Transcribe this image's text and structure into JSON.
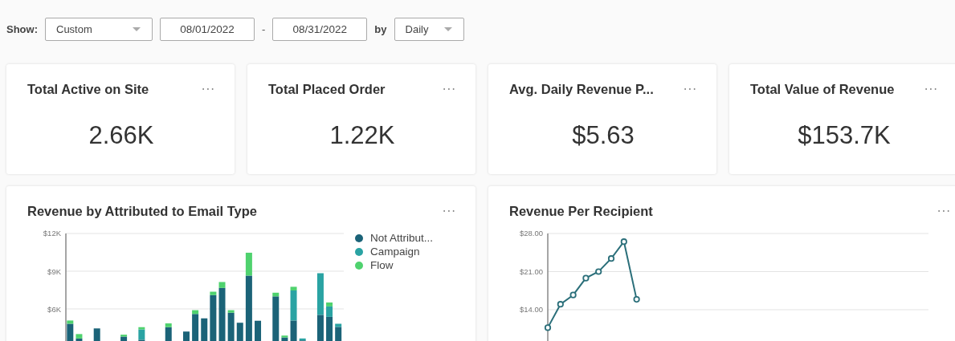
{
  "filter_bar": {
    "show_label": "Show:",
    "range_select": {
      "value": "Custom"
    },
    "start_date": {
      "value": "08/01/2022"
    },
    "separator": "-",
    "end_date": {
      "value": "08/31/2022"
    },
    "by_label": "by",
    "interval_select": {
      "value": "Daily"
    }
  },
  "metrics": [
    {
      "title": "Total Active on Site",
      "menu": "···",
      "value": "2.66K"
    },
    {
      "title": "Total Placed Order",
      "menu": "···",
      "value": "1.22K"
    },
    {
      "title": "Avg. Daily Revenue P...",
      "menu": "···",
      "value": "$5.63"
    },
    {
      "title": "Total Value of Revenue",
      "menu": "···",
      "value": "$153.7K"
    }
  ],
  "charts": [
    {
      "title": "Revenue by Attributed to Email Type",
      "menu": "···",
      "chart_data": {
        "type": "bar",
        "stacked": true,
        "ylim": [
          0,
          12000
        ],
        "yticks": [
          {
            "value": 6000,
            "label": "$6K"
          },
          {
            "value": 9000,
            "label": "$9K"
          },
          {
            "value": 12000,
            "label": "$12K"
          }
        ],
        "series": [
          {
            "name": "Not Attribut...",
            "color": "#1b6378",
            "values": [
              4820,
              3650,
              null,
              4450,
              null,
              null,
              3800,
              null,
              3550,
              null,
              null,
              4550,
              null,
              4200,
              5600,
              5250,
              7100,
              7670,
              5700,
              4900,
              8650,
              5060,
              null,
              7000,
              3730,
              5080,
              3500,
              null,
              5530,
              5370,
              4570
            ]
          },
          {
            "name": "Campaign",
            "color": "#2aa3a3",
            "values": [
              null,
              null,
              null,
              null,
              null,
              null,
              null,
              null,
              820,
              null,
              null,
              null,
              null,
              null,
              null,
              null,
              null,
              null,
              null,
              null,
              null,
              null,
              null,
              null,
              null,
              2390,
              150,
              null,
              3310,
              830,
              250
            ]
          },
          {
            "name": "Flow",
            "color": "#4fd26e",
            "values": [
              260,
              350,
              null,
              null,
              null,
              null,
              150,
              null,
              180,
              null,
              null,
              300,
              null,
              null,
              300,
              null,
              270,
              470,
              200,
              null,
              1820,
              null,
              null,
              290,
              150,
              290,
              null,
              null,
              null,
              310,
              null
            ]
          }
        ]
      }
    },
    {
      "title": "Revenue Per Recipient",
      "menu": "···",
      "chart_data": {
        "type": "line",
        "ylim": [
          8,
          28
        ],
        "yticks": [
          {
            "value": 14,
            "label": "$14.00"
          },
          {
            "value": 21,
            "label": "$21.00"
          },
          {
            "value": 28,
            "label": "$28.00"
          }
        ],
        "series": [
          {
            "color": "#2b6f7a",
            "marker": "circle",
            "values": [
              10.7,
              15.0,
              16.7,
              19.8,
              21.0,
              23.4,
              26.5,
              15.9,
              null,
              null,
              null,
              null,
              null,
              null,
              null,
              null,
              null,
              null,
              null,
              null,
              null,
              null,
              null,
              null,
              null,
              null,
              null,
              null,
              null,
              null,
              null
            ]
          }
        ]
      }
    }
  ]
}
